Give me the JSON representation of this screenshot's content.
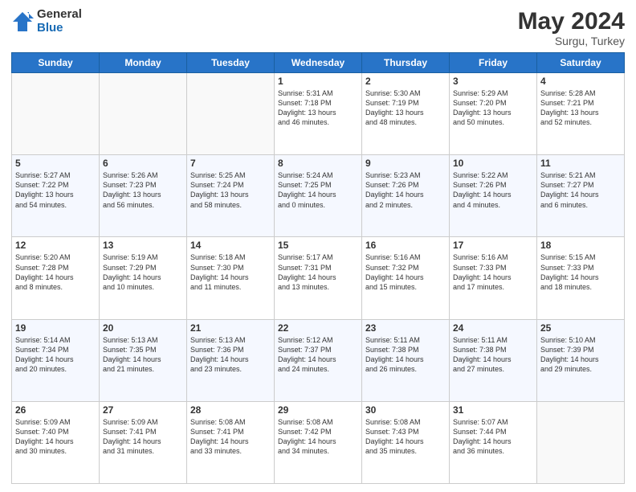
{
  "header": {
    "logo_general": "General",
    "logo_blue": "Blue",
    "month_title": "May 2024",
    "subtitle": "Surgu, Turkey"
  },
  "weekdays": [
    "Sunday",
    "Monday",
    "Tuesday",
    "Wednesday",
    "Thursday",
    "Friday",
    "Saturday"
  ],
  "weeks": [
    [
      {
        "day": "",
        "text": ""
      },
      {
        "day": "",
        "text": ""
      },
      {
        "day": "",
        "text": ""
      },
      {
        "day": "1",
        "text": "Sunrise: 5:31 AM\nSunset: 7:18 PM\nDaylight: 13 hours\nand 46 minutes."
      },
      {
        "day": "2",
        "text": "Sunrise: 5:30 AM\nSunset: 7:19 PM\nDaylight: 13 hours\nand 48 minutes."
      },
      {
        "day": "3",
        "text": "Sunrise: 5:29 AM\nSunset: 7:20 PM\nDaylight: 13 hours\nand 50 minutes."
      },
      {
        "day": "4",
        "text": "Sunrise: 5:28 AM\nSunset: 7:21 PM\nDaylight: 13 hours\nand 52 minutes."
      }
    ],
    [
      {
        "day": "5",
        "text": "Sunrise: 5:27 AM\nSunset: 7:22 PM\nDaylight: 13 hours\nand 54 minutes."
      },
      {
        "day": "6",
        "text": "Sunrise: 5:26 AM\nSunset: 7:23 PM\nDaylight: 13 hours\nand 56 minutes."
      },
      {
        "day": "7",
        "text": "Sunrise: 5:25 AM\nSunset: 7:24 PM\nDaylight: 13 hours\nand 58 minutes."
      },
      {
        "day": "8",
        "text": "Sunrise: 5:24 AM\nSunset: 7:25 PM\nDaylight: 14 hours\nand 0 minutes."
      },
      {
        "day": "9",
        "text": "Sunrise: 5:23 AM\nSunset: 7:26 PM\nDaylight: 14 hours\nand 2 minutes."
      },
      {
        "day": "10",
        "text": "Sunrise: 5:22 AM\nSunset: 7:26 PM\nDaylight: 14 hours\nand 4 minutes."
      },
      {
        "day": "11",
        "text": "Sunrise: 5:21 AM\nSunset: 7:27 PM\nDaylight: 14 hours\nand 6 minutes."
      }
    ],
    [
      {
        "day": "12",
        "text": "Sunrise: 5:20 AM\nSunset: 7:28 PM\nDaylight: 14 hours\nand 8 minutes."
      },
      {
        "day": "13",
        "text": "Sunrise: 5:19 AM\nSunset: 7:29 PM\nDaylight: 14 hours\nand 10 minutes."
      },
      {
        "day": "14",
        "text": "Sunrise: 5:18 AM\nSunset: 7:30 PM\nDaylight: 14 hours\nand 11 minutes."
      },
      {
        "day": "15",
        "text": "Sunrise: 5:17 AM\nSunset: 7:31 PM\nDaylight: 14 hours\nand 13 minutes."
      },
      {
        "day": "16",
        "text": "Sunrise: 5:16 AM\nSunset: 7:32 PM\nDaylight: 14 hours\nand 15 minutes."
      },
      {
        "day": "17",
        "text": "Sunrise: 5:16 AM\nSunset: 7:33 PM\nDaylight: 14 hours\nand 17 minutes."
      },
      {
        "day": "18",
        "text": "Sunrise: 5:15 AM\nSunset: 7:33 PM\nDaylight: 14 hours\nand 18 minutes."
      }
    ],
    [
      {
        "day": "19",
        "text": "Sunrise: 5:14 AM\nSunset: 7:34 PM\nDaylight: 14 hours\nand 20 minutes."
      },
      {
        "day": "20",
        "text": "Sunrise: 5:13 AM\nSunset: 7:35 PM\nDaylight: 14 hours\nand 21 minutes."
      },
      {
        "day": "21",
        "text": "Sunrise: 5:13 AM\nSunset: 7:36 PM\nDaylight: 14 hours\nand 23 minutes."
      },
      {
        "day": "22",
        "text": "Sunrise: 5:12 AM\nSunset: 7:37 PM\nDaylight: 14 hours\nand 24 minutes."
      },
      {
        "day": "23",
        "text": "Sunrise: 5:11 AM\nSunset: 7:38 PM\nDaylight: 14 hours\nand 26 minutes."
      },
      {
        "day": "24",
        "text": "Sunrise: 5:11 AM\nSunset: 7:38 PM\nDaylight: 14 hours\nand 27 minutes."
      },
      {
        "day": "25",
        "text": "Sunrise: 5:10 AM\nSunset: 7:39 PM\nDaylight: 14 hours\nand 29 minutes."
      }
    ],
    [
      {
        "day": "26",
        "text": "Sunrise: 5:09 AM\nSunset: 7:40 PM\nDaylight: 14 hours\nand 30 minutes."
      },
      {
        "day": "27",
        "text": "Sunrise: 5:09 AM\nSunset: 7:41 PM\nDaylight: 14 hours\nand 31 minutes."
      },
      {
        "day": "28",
        "text": "Sunrise: 5:08 AM\nSunset: 7:41 PM\nDaylight: 14 hours\nand 33 minutes."
      },
      {
        "day": "29",
        "text": "Sunrise: 5:08 AM\nSunset: 7:42 PM\nDaylight: 14 hours\nand 34 minutes."
      },
      {
        "day": "30",
        "text": "Sunrise: 5:08 AM\nSunset: 7:43 PM\nDaylight: 14 hours\nand 35 minutes."
      },
      {
        "day": "31",
        "text": "Sunrise: 5:07 AM\nSunset: 7:44 PM\nDaylight: 14 hours\nand 36 minutes."
      },
      {
        "day": "",
        "text": ""
      }
    ]
  ]
}
